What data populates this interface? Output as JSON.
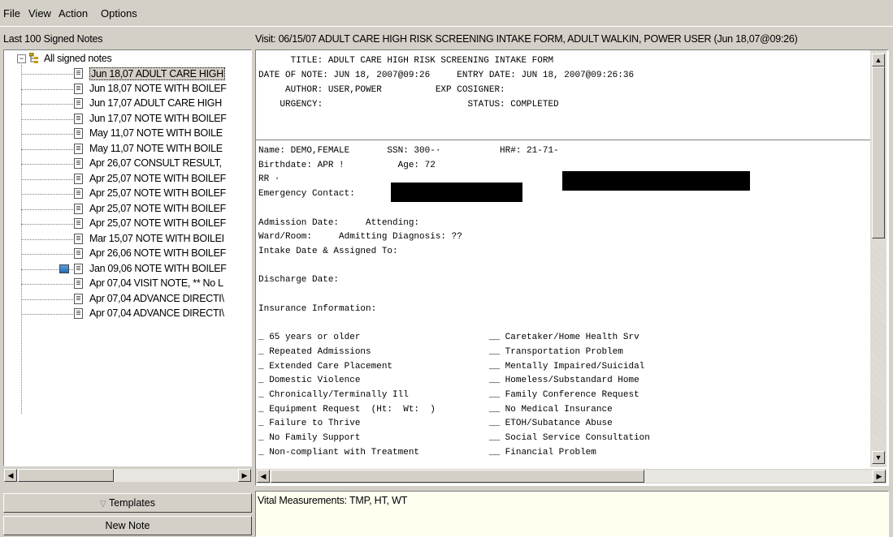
{
  "menu": {
    "file": "File",
    "view": "View",
    "action": "Action",
    "options": "Options"
  },
  "left_panel": {
    "header": "Last 100 Signed Notes",
    "root_label": "All signed notes",
    "notes": [
      {
        "label": "Jun 18,07  ADULT CARE HIGH"
      },
      {
        "label": "Jun 18,07  NOTE WITH BOILEF"
      },
      {
        "label": "Jun 17,07  ADULT CARE HIGH"
      },
      {
        "label": "Jun 17,07  NOTE WITH BOILEF"
      },
      {
        "label": "May 11,07  NOTE WITH BOILE"
      },
      {
        "label": "May 11,07  NOTE WITH BOILE"
      },
      {
        "label": "Apr 26,07  CONSULT RESULT,"
      },
      {
        "label": "Apr 25,07  NOTE WITH BOILEF"
      },
      {
        "label": "Apr 25,07  NOTE WITH BOILEF"
      },
      {
        "label": "Apr 25,07  NOTE WITH BOILEF"
      },
      {
        "label": "Apr 25,07  NOTE WITH BOILEF"
      },
      {
        "label": "Mar 15,07  NOTE WITH BOILEI"
      },
      {
        "label": "Apr 26,06  NOTE WITH BOILEF"
      },
      {
        "label": "Jan 09,06  NOTE WITH BOILEF"
      },
      {
        "label": "Apr 07,04  VISIT NOTE, ** No L"
      },
      {
        "label": "Apr 07,04  ADVANCE DIRECTI\\"
      },
      {
        "label": "Apr 07,04  ADVANCE DIRECTI\\"
      }
    ],
    "templates_button": "Templates",
    "templates_arrow": "▽",
    "new_note_button": "New Note"
  },
  "visit_header": "Visit: 06/15/07  ADULT CARE HIGH RISK SCREENING INTAKE FORM, ADULT WALKIN, POWER USER  (Jun 18,07@09:26)",
  "note": {
    "header_lines": [
      "      TITLE: ADULT CARE HIGH RISK SCREENING INTAKE FORM",
      "DATE OF NOTE: JUN 18, 2007@09:26     ENTRY DATE: JUN 18, 2007@09:26:36",
      "     AUTHOR: USER,POWER          EXP COSIGNER:",
      "    URGENCY:                           STATUS: COMPLETED"
    ],
    "body_lines": [
      "Name: DEMO,FEMALE       SSN: 300-·           HR#: 21-71-",
      "Birthdate: APR !          Age: 72",
      "RR ·",
      "Emergency Contact:",
      "",
      "Admission Date:     Attending:",
      "Ward/Room:     Admitting Diagnosis: ??",
      "Intake Date & Assigned To:",
      "",
      "Discharge Date:",
      "",
      "Insurance Information:",
      "",
      "_ 65 years or older                        __ Caretaker/Home Health Srv",
      "_ Repeated Admissions                      __ Transportation Problem",
      "_ Extended Care Placement                  __ Mentally Impaired/Suicidal",
      "_ Domestic Violence                        __ Homeless/Substandard Home",
      "_ Chronically/Terminally Ill               __ Family Conference Request",
      "_ Equipment Request  (Ht:  Wt:  )          __ No Medical Insurance",
      "_ Failure to Thrive                        __ ETOH/Subatance Abuse",
      "_ No Family Support                        __ Social Service Consultation",
      "_ Non-compliant with Treatment             __ Financial Problem"
    ]
  },
  "vitals": "Vital Measurements: TMP, HT, WT"
}
